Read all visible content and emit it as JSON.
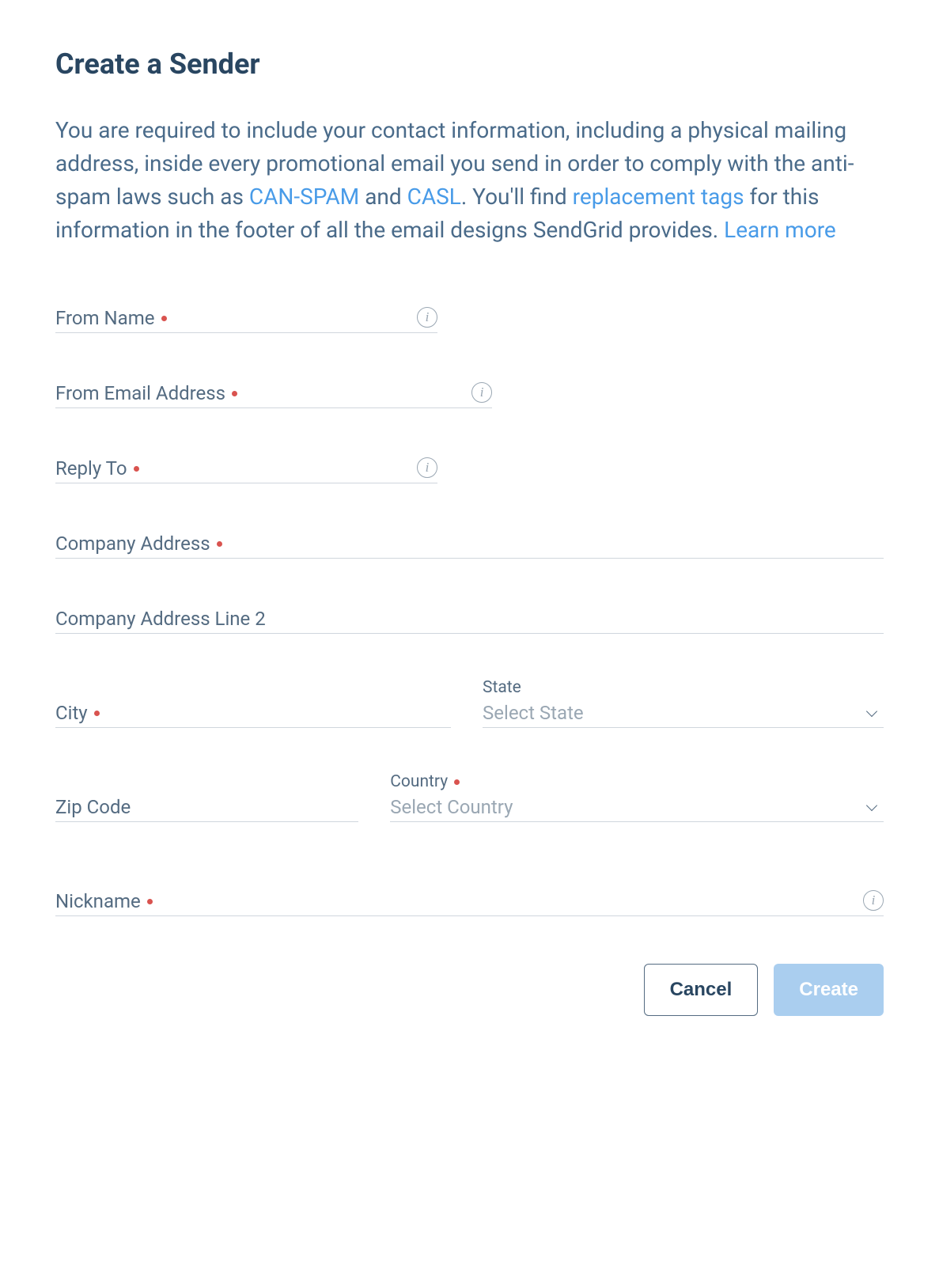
{
  "title": "Create a Sender",
  "intro": {
    "pre": "You are required to include your contact information, including a physical mailing address, inside every promotional email you send in order to comply with the anti-spam laws such as ",
    "link_canspam": "CAN-SPAM",
    "mid1": " and ",
    "link_casl": "CASL",
    "mid2": ". You'll find ",
    "link_replacement": "replacement tags",
    "post1": " for this information in the footer of all the email designs SendGrid provides. ",
    "link_learn": "Learn more"
  },
  "fields": {
    "from_name": {
      "label": "From Name",
      "required": true,
      "value": "",
      "has_info": true
    },
    "from_email": {
      "label": "From Email Address",
      "required": true,
      "value": "",
      "has_info": true
    },
    "reply_to": {
      "label": "Reply To",
      "required": true,
      "value": "",
      "has_info": true
    },
    "company_address": {
      "label": "Company Address",
      "required": true,
      "value": "",
      "has_info": false
    },
    "company_address2": {
      "label": "Company Address Line 2",
      "required": false,
      "value": "",
      "has_info": false
    },
    "city": {
      "label": "City",
      "required": true,
      "value": "",
      "has_info": false
    },
    "state": {
      "label": "State",
      "placeholder": "Select State",
      "required": false
    },
    "zip": {
      "label": "Zip Code",
      "required": false,
      "value": "",
      "has_info": false
    },
    "country": {
      "label": "Country",
      "placeholder": "Select Country",
      "required": true
    },
    "nickname": {
      "label": "Nickname",
      "required": true,
      "value": "",
      "has_info": true
    }
  },
  "actions": {
    "cancel": "Cancel",
    "create": "Create"
  }
}
